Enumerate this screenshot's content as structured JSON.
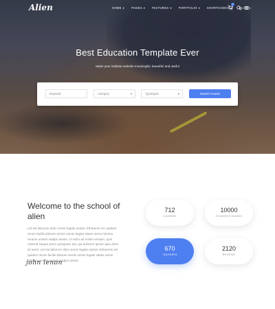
{
  "header": {
    "logo": "Alien",
    "nav": [
      {
        "label": "HOME",
        "caret": "▾"
      },
      {
        "label": "PAGES",
        "caret": "▾"
      },
      {
        "label": "FEATURES",
        "caret": "▾"
      },
      {
        "label": "PORTFOLIO",
        "caret": "▾"
      },
      {
        "label": "SHORTCODES",
        "caret": "▾"
      },
      {
        "label": "BLOG",
        "caret": "▾"
      }
    ],
    "cart_count": "0"
  },
  "hero": {
    "title": "Best Education Template Ever",
    "subtitle": "Make your institute website meaningful, beautiful and useful"
  },
  "search": {
    "keyword_placeholder": "Keyword",
    "category_label": "Category",
    "typologies_label": "Typologies",
    "chevron": "▾",
    "button_label": "Search Course"
  },
  "welcome": {
    "title": "Welcome to the school of alien",
    "text": "Lid est laborum dolo rumes fugats untras. Etharums ser quidem rerum facilis dolores nemis omnis fugats vitaes nemo minima rerums unsers sadips amets. Ut enim ad minim veniam, quis nostrud Neque porro quisquam est, qui dolorem ipsum quia dolor sit amet. Lid est laborum dolo rumes fugats untras. Etharums ser quidem rerum facilis dolores nemis omnis fugats vitaes nemo minima rerums unsers sadips amets.",
    "signature": "john lenon"
  },
  "stats": [
    {
      "value": "712",
      "label": "COURSES"
    },
    {
      "value": "10000",
      "label": "STUDENTS PASSED"
    },
    {
      "value": "670",
      "label": "TEACHERS"
    },
    {
      "value": "2120",
      "label": "REVIEWS"
    }
  ],
  "colors": {
    "accent": "#4e7ff0",
    "body_text": "#8a8a8a",
    "heading": "#333333"
  }
}
